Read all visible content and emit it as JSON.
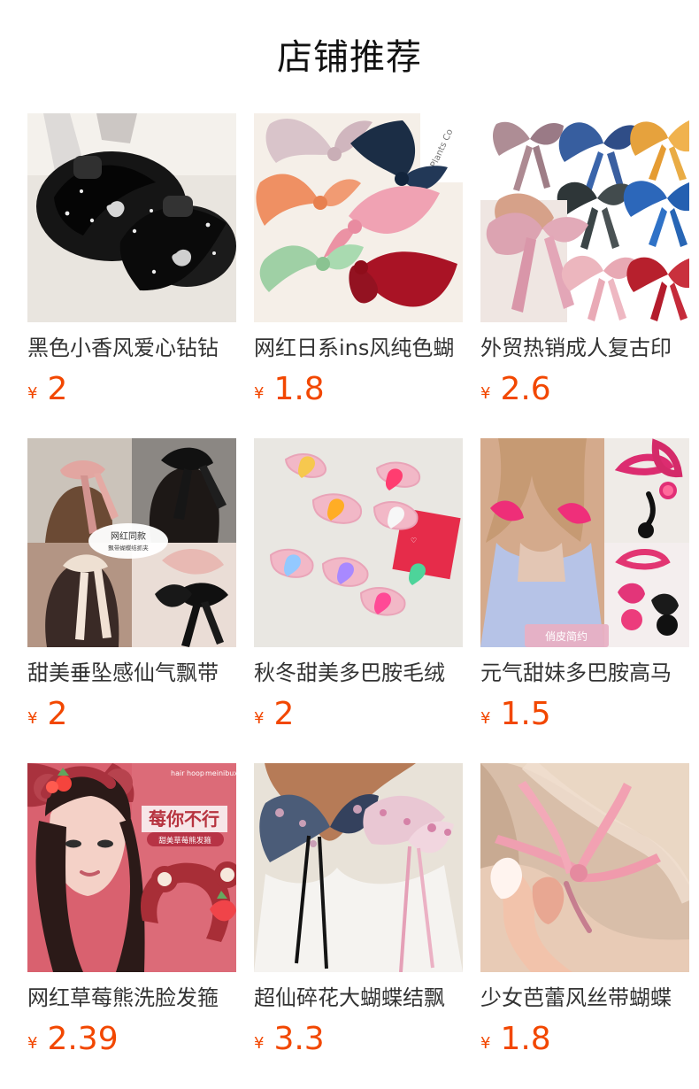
{
  "header": {
    "title": "店铺推荐"
  },
  "products": [
    {
      "name": "黑色小香风爱心钻钻",
      "currency": "¥",
      "price": "2",
      "image_icon": "black-bow-claw-clip-icon"
    },
    {
      "name": "网红日系ins风纯色蝴",
      "currency": "¥",
      "price": "1.8",
      "image_icon": "pastel-bow-clips-icon",
      "image_text": "Plants Co"
    },
    {
      "name": "外贸热销成人复古印",
      "currency": "¥",
      "price": "2.6",
      "image_icon": "printed-bow-collection-icon"
    },
    {
      "name": "甜美垂坠感仙气飘带",
      "currency": "¥",
      "price": "2",
      "image_icon": "long-bow-hair-styles-icon",
      "image_text": "网红同款",
      "image_subtext": "飘带蝴蝶结抓夹"
    },
    {
      "name": "秋冬甜美多巴胺毛绒",
      "currency": "¥",
      "price": "2",
      "image_icon": "fuzzy-heart-claw-clip-icon"
    },
    {
      "name": "元气甜妹多巴胺高马",
      "currency": "¥",
      "price": "1.5",
      "image_icon": "pink-knot-hair-tie-icon",
      "image_text": "俏皮简约"
    },
    {
      "name": "网红草莓熊洗脸发箍",
      "currency": "¥",
      "price": "2.39",
      "image_icon": "strawberry-bear-headband-icon",
      "image_text": "莓你不行",
      "image_subtext": "甜美草莓熊发箍",
      "image_caption_left": "hair hoop",
      "image_caption_right": "meinibuxing"
    },
    {
      "name": "超仙碎花大蝴蝶结飘",
      "currency": "¥",
      "price": "3.3",
      "image_icon": "floral-bow-ribbon-clip-icon"
    },
    {
      "name": "少女芭蕾风丝带蝴蝶",
      "currency": "¥",
      "price": "1.8",
      "image_icon": "pink-ribbon-hair-clip-icon"
    }
  ]
}
